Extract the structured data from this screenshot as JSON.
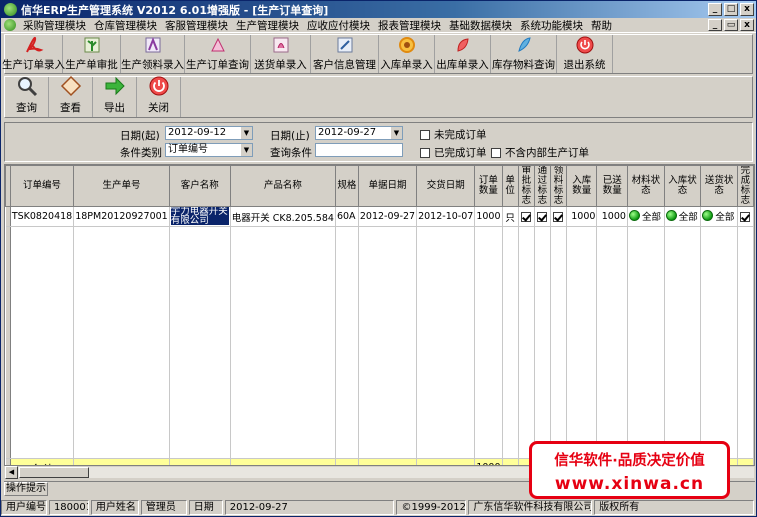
{
  "window": {
    "title": "信华ERP生产管理系统  V2012  6.01增强版 - [生产订单查询]",
    "controls": [
      "_",
      "□",
      "x"
    ],
    "mdi_controls": [
      "_",
      "▭",
      "x"
    ]
  },
  "menu": [
    "采购管理模块",
    "仓库管理模块",
    "客服管理模块",
    "生产管理模块",
    "应收应付模块",
    "报表管理模块",
    "基础数据模块",
    "系统功能模块",
    "帮助"
  ],
  "toolbar": [
    {
      "label": "生产订单录入",
      "icon": "acrobat-icon",
      "color": "#d42020"
    },
    {
      "label": "生产单审批",
      "icon": "plant-icon",
      "color": "#2a8a2a"
    },
    {
      "label": "生产领料录入",
      "icon": "flower-icon",
      "color": "#8a3aa0"
    },
    {
      "label": "生产订单查询",
      "icon": "fan-icon",
      "color": "#c03070"
    },
    {
      "label": "送货单录入",
      "icon": "tulip-icon",
      "color": "#b02060"
    },
    {
      "label": "客户信息管理",
      "icon": "palette-icon",
      "color": "#3060a0"
    },
    {
      "label": "入库单录入",
      "icon": "sunflower-icon",
      "color": "#e08a10"
    },
    {
      "label": "出库单录入",
      "icon": "leaf-icon",
      "color": "#c02020"
    },
    {
      "label": "库存物料查询",
      "icon": "feather-icon",
      "color": "#207ac0"
    },
    {
      "label": "退出系统",
      "icon": "power-icon",
      "color": "#e03030"
    }
  ],
  "subtoolbar": [
    {
      "label": "查询",
      "icon": "magnifier-icon"
    },
    {
      "label": "查看",
      "icon": "diamond-icon"
    },
    {
      "label": "导出",
      "icon": "arrow-right-icon"
    },
    {
      "label": "关闭",
      "icon": "power-icon"
    }
  ],
  "filter": {
    "date_from_label": "日期(起)",
    "date_from": "2012-09-12",
    "date_to_label": "日期(止)",
    "date_to": "2012-09-27",
    "category_label": "条件类别",
    "category": "订单编号",
    "query_label": "查询条件",
    "query_value": "",
    "chk_unfinished": "未完成订单",
    "chk_finished": "已完成订单",
    "chk_exclude_internal": "不含内部生产订单"
  },
  "grid": {
    "columns": [
      "订单编号",
      "生产单号",
      "客户名称",
      "产品名称",
      "规格",
      "单据日期",
      "交货日期",
      "订单\n数量",
      "单位",
      "审批\n标志",
      "通过\n标志",
      "领料\n标志",
      "入库数量",
      "已送数量",
      "材料状态",
      "入库状态",
      "送货状态",
      "完成\n标志"
    ],
    "row": {
      "order_no": "TSK0820418",
      "prod_no": "18PM20120927001",
      "customer": "宇力电器开关有限公司",
      "product": "电器开关 CK8.205.584",
      "spec": "60A",
      "bill_date": "2012-09-27",
      "delivery_date": "2012-10-07",
      "qty": "1000",
      "unit": "只",
      "in_qty": "1000",
      "sent_qty": "1000",
      "material_status": "全部",
      "in_status": "全部",
      "delivery_status": "全部"
    },
    "total_label": "合 计",
    "total_qty": "1000"
  },
  "tip_tab": "操作提示",
  "status": {
    "user_no_label": "用户编号",
    "user_no": "180001",
    "user_name_label": "用户姓名",
    "user_name": "管理员",
    "date_label": "日期",
    "date": "2012-09-27",
    "copyright": "©1999-2012?",
    "company": "广东信华软件科技有限公司",
    "rights": "版权所有"
  },
  "watermark": {
    "line1": "信华软件·品质决定价值",
    "line2": "www.xinwa.cn"
  }
}
